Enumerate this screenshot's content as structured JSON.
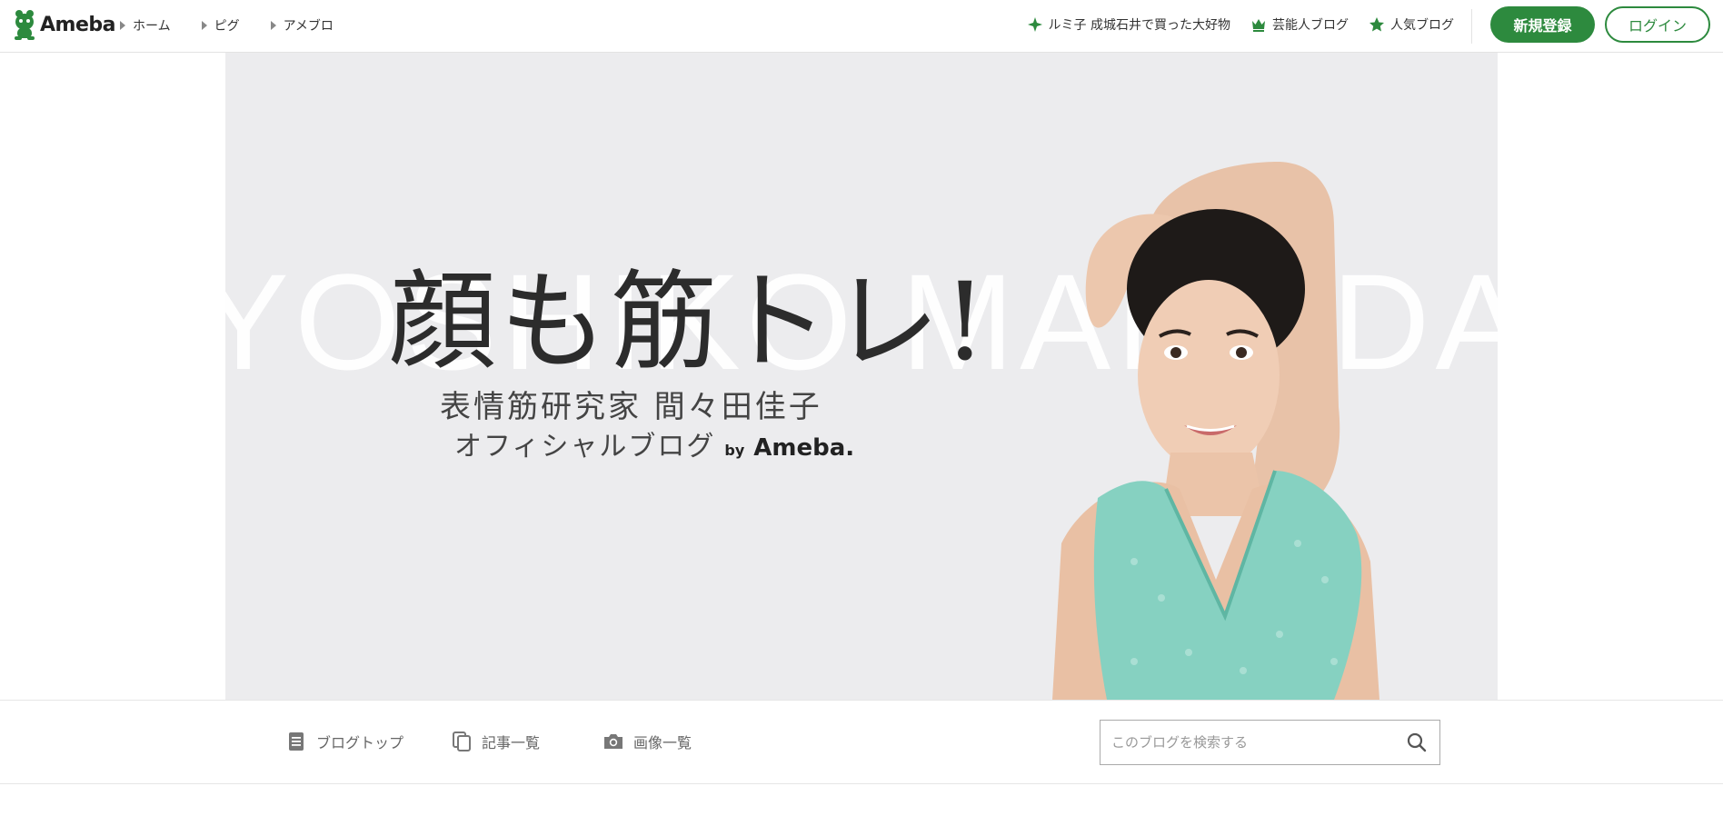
{
  "header": {
    "logo_text": "Ameba",
    "breadcrumbs": [
      "ホーム",
      "ピグ",
      "アメブロ"
    ],
    "links": [
      {
        "label": "ルミ子 成城石井で買った大好物",
        "icon": "sparkle-icon"
      },
      {
        "label": "芸能人ブログ",
        "icon": "crown-icon"
      },
      {
        "label": "人気ブログ",
        "icon": "star-icon"
      }
    ],
    "register_label": "新規登録",
    "login_label": "ログイン"
  },
  "banner": {
    "bg_name": "YOSHIKO MAMADA",
    "title": "顔も筋トレ!",
    "subtitle1": "表情筋研究家 間々田佳子",
    "subtitle2": "オフィシャルブログ",
    "by": "by",
    "by_brand": "Ameba."
  },
  "subnav": {
    "items": [
      {
        "label": "ブログトップ",
        "icon": "document-icon"
      },
      {
        "label": "記事一覧",
        "icon": "copy-icon"
      },
      {
        "label": "画像一覧",
        "icon": "camera-icon"
      }
    ],
    "search_placeholder": "このブログを検索する"
  },
  "colors": {
    "brand_green": "#2d8a3e",
    "banner_bg": "#ececee"
  }
}
